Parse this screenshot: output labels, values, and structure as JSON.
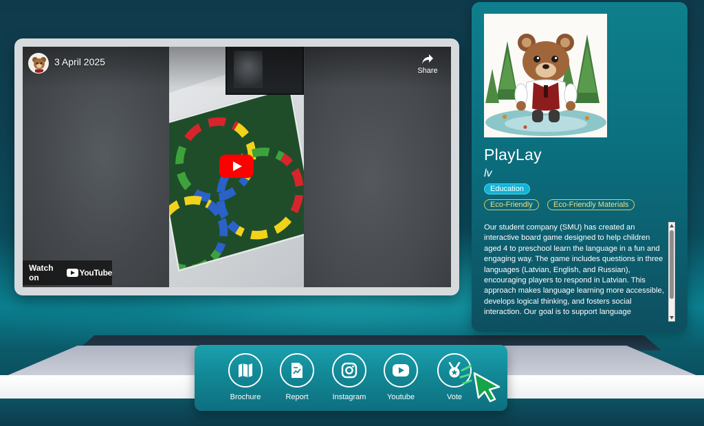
{
  "video": {
    "date": "3 April 2025",
    "share_label": "Share",
    "watch_on_label": "Watch on",
    "youtube_wordmark": "YouTube"
  },
  "project": {
    "title": "PlayLay",
    "language": "lv",
    "category_tag": "Education",
    "tags": [
      "Eco-Friendly",
      "Eco-Friendly Materials"
    ],
    "description": "Our student company (SMU) has created an interactive board game designed to help children aged 4 to preschool learn the language in a fun and engaging way. The game includes questions in three languages (Latvian, English, and Russian), encouraging players to respond in Latvian. This approach makes language learning more accessible, develops logical thinking, and fosters social interaction. Our goal is to support language"
  },
  "toolbar": {
    "items": [
      {
        "label": "Brochure",
        "icon": "brochure-icon"
      },
      {
        "label": "Report",
        "icon": "report-icon"
      },
      {
        "label": "Instagram",
        "icon": "instagram-icon"
      },
      {
        "label": "Youtube",
        "icon": "youtube-icon"
      },
      {
        "label": "Vote",
        "icon": "vote-medal-icon"
      }
    ]
  },
  "colors": {
    "accent": "#128896",
    "panel": "#0b6f7e",
    "tag_primary": "#12b3d6",
    "tag_outline": "#d8cf6b",
    "youtube_red": "#ff0000",
    "cursor_green": "#16a34a"
  }
}
